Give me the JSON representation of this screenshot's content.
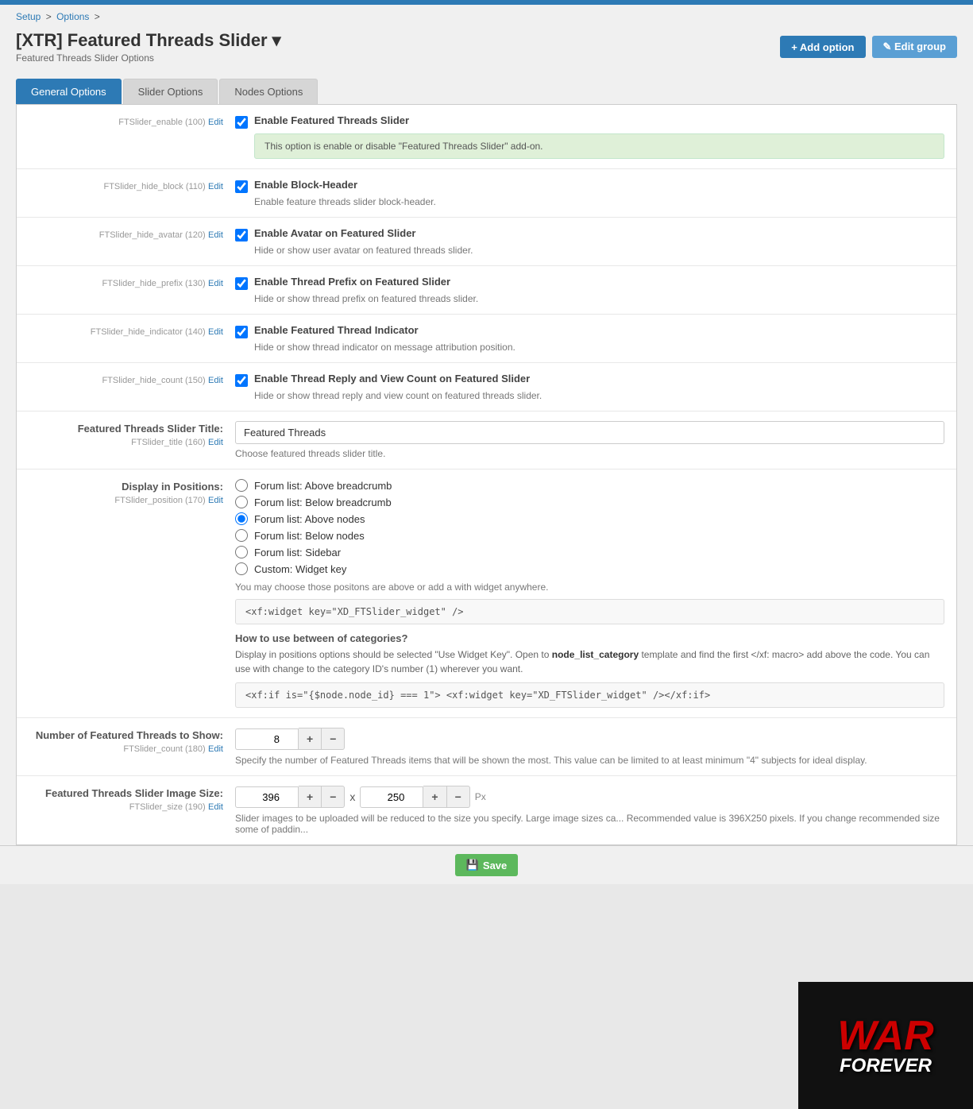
{
  "topbar": {
    "color": "#2d7ab5"
  },
  "breadcrumb": {
    "setup": "Setup",
    "options": "Options",
    "separator": ">"
  },
  "header": {
    "title": "[XTR] Featured Threads Slider",
    "title_icon": "▾",
    "subtitle": "Featured Threads Slider Options",
    "add_option_label": "+ Add option",
    "edit_group_label": "✎ Edit group"
  },
  "tabs": [
    {
      "label": "General Options",
      "active": true
    },
    {
      "label": "Slider Options",
      "active": false
    },
    {
      "label": "Nodes Options",
      "active": false
    }
  ],
  "options": [
    {
      "field_id": "FTSlider_enable (100)",
      "field_edit": "Edit",
      "type": "checkbox",
      "checked": true,
      "label": "Enable Featured Threads Slider",
      "notice": "This option is enable or disable \"Featured Threads Slider\" add-on.",
      "hint": ""
    },
    {
      "field_id": "FTSlider_hide_block (110)",
      "field_edit": "Edit",
      "type": "checkbox",
      "checked": true,
      "label": "Enable Block-Header",
      "notice": "",
      "hint": "Enable feature threads slider block-header."
    },
    {
      "field_id": "FTSlider_hide_avatar (120)",
      "field_edit": "Edit",
      "type": "checkbox",
      "checked": true,
      "label": "Enable Avatar on Featured Slider",
      "notice": "",
      "hint": "Hide or show user avatar on featured threads slider."
    },
    {
      "field_id": "FTSlider_hide_prefix (130)",
      "field_edit": "Edit",
      "type": "checkbox",
      "checked": true,
      "label": "Enable Thread Prefix on Featured Slider",
      "notice": "",
      "hint": "Hide or show thread prefix on featured threads slider."
    },
    {
      "field_id": "FTSlider_hide_indicator (140)",
      "field_edit": "Edit",
      "type": "checkbox",
      "checked": true,
      "label": "Enable Featured Thread Indicator",
      "notice": "",
      "hint": "Hide or show thread indicator on message attribution position."
    },
    {
      "field_id": "FTSlider_hide_count (150)",
      "field_edit": "Edit",
      "type": "checkbox",
      "checked": true,
      "label": "Enable Thread Reply and View Count on Featured Slider",
      "notice": "",
      "hint": "Hide or show thread reply and view count on featured threads slider."
    },
    {
      "field_id": "FTSlider_title (160)",
      "field_edit": "Edit",
      "title_label": "Featured Threads Slider Title:",
      "type": "text",
      "value": "Featured Threads",
      "hint": "Choose featured threads slider title."
    },
    {
      "field_id": "FTSlider_position (170)",
      "field_edit": "Edit",
      "title_label": "Display in Positions:",
      "type": "radio",
      "options": [
        {
          "label": "Forum list: Above breadcrumb",
          "checked": false
        },
        {
          "label": "Forum list: Below breadcrumb",
          "checked": false
        },
        {
          "label": "Forum list: Above nodes",
          "checked": true
        },
        {
          "label": "Forum list: Below nodes",
          "checked": false
        },
        {
          "label": "Forum list: Sidebar",
          "checked": false
        },
        {
          "label": "Custom: Widget key",
          "checked": false
        }
      ],
      "position_hint": "You may choose those positons are above or add a with widget anywhere.",
      "widget_code": "<xf:widget key=\"XD_FTSlider_widget\" />",
      "how_to_title": "How to use between of categories?",
      "how_to_text_1": "Display in positions options should be selected \"Use Widget Key\". Open to ",
      "how_to_bold": "node_list_category",
      "how_to_text_2": " template and find the first </xf: macro> add above the code. You can use with change to the category ID's number (1) wherever you want.",
      "category_code": "<xf:if is=\"{$node.node_id} === 1\">  <xf:widget key=\"XD_FTSlider_widget\" /></xf:if>"
    },
    {
      "field_id": "FTSlider_count (180)",
      "field_edit": "Edit",
      "title_label": "Number of Featured Threads to Show:",
      "type": "number",
      "value": "8",
      "hint": "Specify the number of Featured Threads items that will be shown the most. This value can be limited to at least minimum \"4\" subjects for ideal display."
    },
    {
      "field_id": "FTSlider_size (190)",
      "field_edit": "Edit",
      "title_label": "Featured Threads Slider Image Size:",
      "type": "size",
      "width": "396",
      "height": "250",
      "size_hint": "Slider images to be uploaded will be reduced to the size you specify. Large image sizes ca... Recommended value is 396X250 pixels. If you change recommended size some of paddin..."
    }
  ],
  "save_button": "💾 Save"
}
